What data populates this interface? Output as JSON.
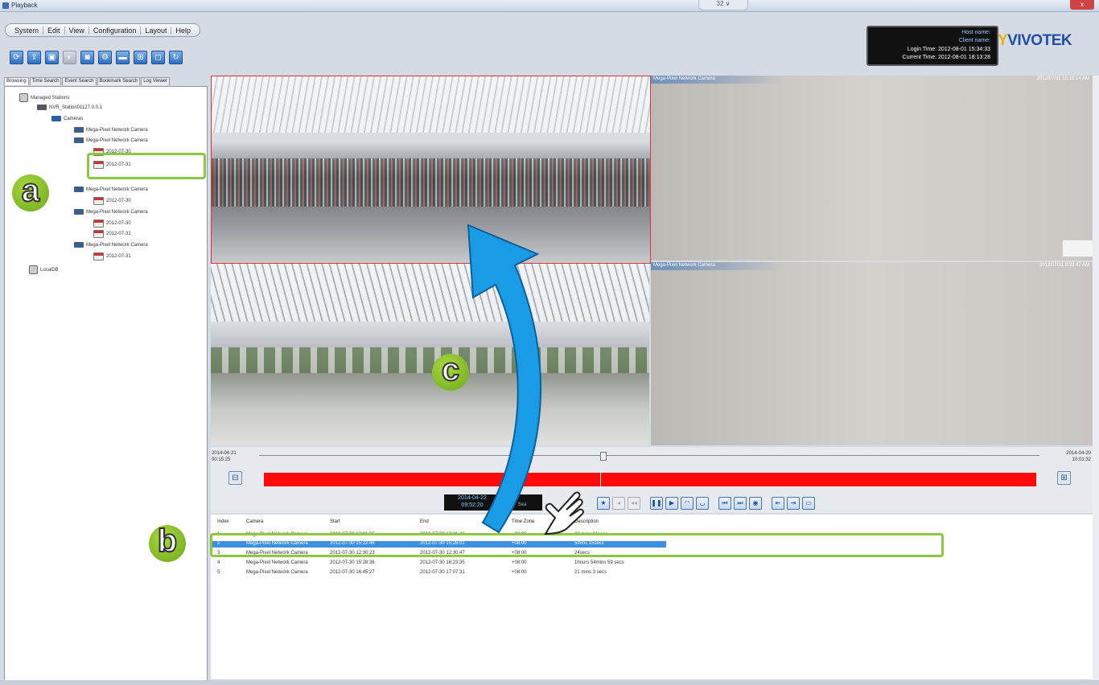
{
  "window": {
    "title": "Playback",
    "mid_tab": "32 ∨",
    "close_label": "x"
  },
  "menu": [
    "System",
    "Edit",
    "View",
    "Configuration",
    "Layout",
    "Help"
  ],
  "toolbar_icons": [
    "refresh-icon",
    "export-icon",
    "lock-icon",
    "snapshot-disabled-icon",
    "camera-icon",
    "settings-icon",
    "video-icon",
    "grid-icon",
    "fullscreen-icon",
    "sync-icon"
  ],
  "info": {
    "line1": "Host name: ",
    "line2": "Client name: ",
    "line3": "Login Time: 2012-08-01 15:34:33",
    "line4": "Current Time: 2012-08-01 18:13:28"
  },
  "brand": {
    "logo_y": "Y",
    "logo_text": "VIVOTEK"
  },
  "left_tabs": [
    "Browsing",
    "Time Search",
    "Event Search",
    "Bookmark Search",
    "Log Viewer"
  ],
  "tree": {
    "root": "Managed Stations",
    "station": "NVR_Station01127.0.0.1",
    "cameras": "Cameras",
    "cam1": "Mega-Pixel Network Camera",
    "cam2": "Mega-Pixel Network Camera",
    "cam2_d1": "2012-07-30",
    "cam2_d2": "2012-07-31",
    "cam3": "Mega-Pixel Network Camera",
    "cam3_d1": "2012-07-30",
    "cam4": "Mega-Pixel Network Camera",
    "cam4_d1": "2012-07-30",
    "cam4_d2": "2012-07-31",
    "cam5": "Mega-Pixel Network Camera",
    "cam5_d1": "2012-07-31",
    "local": "LocalDB"
  },
  "videos": {
    "v2_name": "Mega-Pixel Network Camera",
    "v2_time": "2012/07/31 10:10:14 AM",
    "v4_name": "Mega-Pixel Network Camera",
    "v4_time": "2012/07/31 9:33:47 AM"
  },
  "timeline": {
    "start_date": "2014-04-21",
    "start_time": "00:15:25",
    "end_date": "2014-04-20",
    "end_time": "10:01:32",
    "clock_date": "2014-04-22",
    "clock_time": "09:52:20",
    "clock2_top": "",
    "clock2_bottom": "Sea"
  },
  "table": {
    "headers": [
      "Index",
      "Camera",
      "Start",
      "End",
      "Time Zone",
      "Description"
    ],
    "rows": [
      [
        "1",
        "Mega-Pixel Network Camera",
        "2012-07-30 12:01:35",
        "2012-07-30 12:21:46",
        "+08:00",
        "20 mins 11secs"
      ],
      [
        "2",
        "Mega-Pixel Network Camera",
        "2012-07-30 15:22:46",
        "2012-07-30 15:28:01",
        "+08:00",
        "5mins 15secs"
      ],
      [
        "3",
        "Mega-Pixel Network Camera",
        "2012-07-30 12:30:23",
        "2012-07-30 12:30:47",
        "+08:00",
        "24secs"
      ],
      [
        "4",
        "Mega-Pixel Network Camera",
        "2012-07-30 15:28:36",
        "2012-07-30 16:23:35",
        "+08:00",
        "1hours 54mins 59 secs"
      ],
      [
        "5",
        "Mega-Pixel Network Camera",
        "2012-07-30 16:45:27",
        "2012-07-30 17:07:31",
        "+08:00",
        "21 mins 3 secs"
      ]
    ]
  },
  "callouts": {
    "a": "a",
    "b": "b",
    "c": "c"
  }
}
